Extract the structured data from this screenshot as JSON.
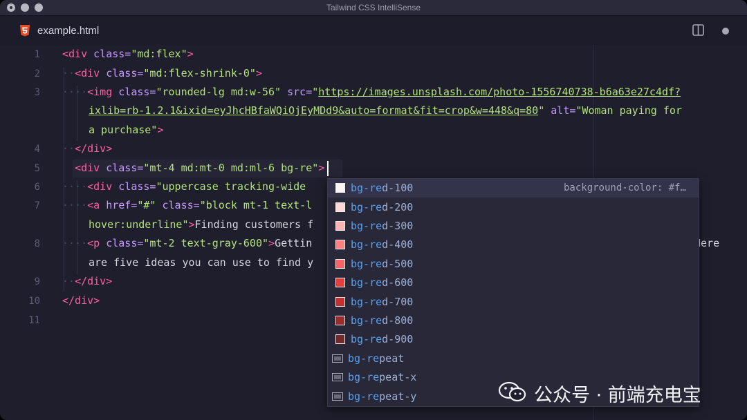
{
  "window": {
    "title": "Tailwind CSS IntelliSense"
  },
  "tab": {
    "filename": "example.html",
    "icon": "html5-icon"
  },
  "toolbar": {
    "split_icon": "split-editor-icon",
    "dirty_icon": "unsaved-dot-icon"
  },
  "line_numbers": [
    "1",
    "2",
    "3",
    "4",
    "5",
    "6",
    "7",
    "8",
    "9",
    "10",
    "11"
  ],
  "code": {
    "l1": {
      "ws": "",
      "open": "<div",
      "attr": " class=",
      "val": "\"md:flex\"",
      "close": ">"
    },
    "l2": {
      "ws": "··",
      "open": "<div",
      "attr": " class=",
      "val": "\"md:flex-shrink-0\"",
      "close": ">"
    },
    "l3": {
      "ws": "····",
      "open": "<img",
      "attr1": " class=",
      "val1": "\"rounded-lg md:w-56\"",
      "attr2": " src=",
      "q": "\"",
      "url1": "https://images.unsplash.com/photo-1556740738-b6a63e27c4df?",
      "url2": "ixlib=rb-1.2.1&ixid=eyJhcHBfaWQiOjEyMDd9&auto=format&fit=crop&w=448&q=80",
      "q2": "\"",
      "attr3": " alt=",
      "val3a": "\"Woman paying for",
      "val3b": "a purchase\"",
      "close": ">"
    },
    "l4": {
      "ws": "··",
      "tag": "</div>"
    },
    "l5": {
      "ws": "",
      "open": "<div",
      "attr": " class=",
      "val": "\"mt-4 md:mt-0 md:ml-6 bg-re",
      "q": "\"",
      "close": ">"
    },
    "l6": {
      "ws": "····",
      "open": "<div",
      "attr": " class=",
      "val": "\"uppercase tracking-wide"
    },
    "l7": {
      "ws": "····",
      "open": "<a",
      "attr1": " href=",
      "val1": "\"#\"",
      "attr2": " class=",
      "val2": "\"block mt-1 text-l",
      "val2b": "hover:underline\"",
      "close": ">",
      "text": "Finding customers f"
    },
    "l8": {
      "ws": "····",
      "open": "<p",
      "attr": " class=",
      "val": "\"mt-2 text-gray-600\"",
      "close": ">",
      "text": "Gettin",
      "tail": "Here",
      "text2": "are five ideas you can use to find y"
    },
    "l9": {
      "ws": "··",
      "tag": "</div>"
    },
    "l10": {
      "ws": "",
      "tag": "</div>"
    }
  },
  "suggestions": [
    {
      "prefix": "bg-re",
      "rest": "d-100",
      "color": "#fff5f5",
      "detail": "background-color: #f…",
      "kind": "color"
    },
    {
      "prefix": "bg-re",
      "rest": "d-200",
      "color": "#fed7d7",
      "kind": "color"
    },
    {
      "prefix": "bg-re",
      "rest": "d-300",
      "color": "#feb2b2",
      "kind": "color"
    },
    {
      "prefix": "bg-re",
      "rest": "d-400",
      "color": "#fc8181",
      "kind": "color"
    },
    {
      "prefix": "bg-re",
      "rest": "d-500",
      "color": "#f56565",
      "kind": "color"
    },
    {
      "prefix": "bg-re",
      "rest": "d-600",
      "color": "#e53e3e",
      "kind": "color"
    },
    {
      "prefix": "bg-re",
      "rest": "d-700",
      "color": "#c53030",
      "kind": "color"
    },
    {
      "prefix": "bg-re",
      "rest": "d-800",
      "color": "#9b2c2c",
      "kind": "color"
    },
    {
      "prefix": "bg-re",
      "rest": "d-900",
      "color": "#742a2a",
      "kind": "color"
    },
    {
      "prefix": "bg-re",
      "rest": "peat",
      "kind": "enum"
    },
    {
      "prefix": "bg-re",
      "rest": "peat-x",
      "kind": "enum"
    },
    {
      "prefix": "bg-re",
      "rest": "peat-y",
      "kind": "enum"
    }
  ],
  "watermark": {
    "text": "公众号 · 前端充电宝",
    "icon": "wechat-icon"
  }
}
